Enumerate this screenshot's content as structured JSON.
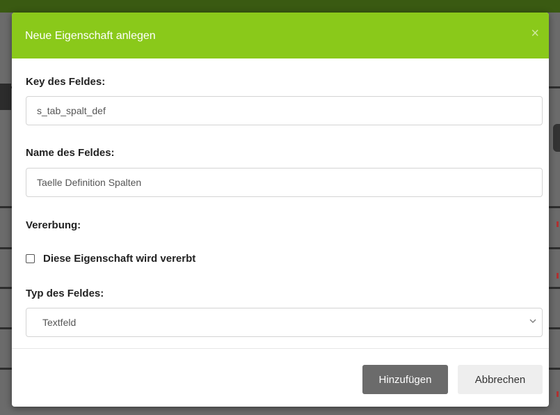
{
  "dialog": {
    "title": "Neue Eigenschaft anlegen",
    "close_glyph": "×"
  },
  "fields": {
    "key": {
      "label": "Key des Feldes:",
      "value": "s_tab_spalt_def"
    },
    "name": {
      "label": "Name des Feldes:",
      "value": "Taelle Definition Spalten"
    },
    "inheritance": {
      "label": "Vererbung:",
      "checkbox_label": "Diese Eigenschaft wird vererbt",
      "checked": false
    },
    "type": {
      "label": "Typ des Feldes:",
      "selected": "Textfeld"
    }
  },
  "buttons": {
    "add": "Hinzufügen",
    "cancel": "Abbrechen"
  },
  "colors": {
    "header": "#8ac91a",
    "primary_button": "#6b6b6b",
    "secondary_button": "#eeeeee"
  },
  "icons": {
    "close": "close-icon",
    "dropdown": "chevron-down-icon"
  }
}
